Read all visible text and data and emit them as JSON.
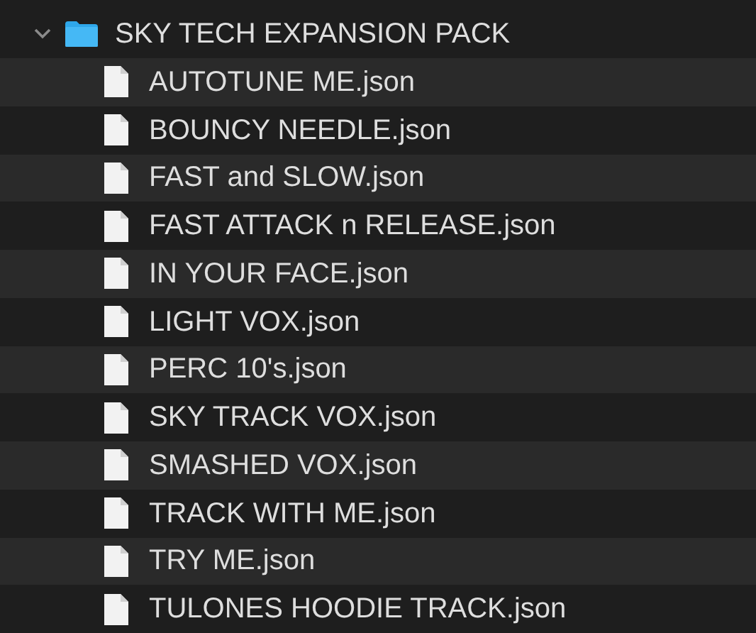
{
  "folder": {
    "name": "SKY TECH EXPANSION PACK",
    "expanded": true,
    "children": [
      {
        "name": "AUTOTUNE ME.json"
      },
      {
        "name": "BOUNCY NEEDLE.json"
      },
      {
        "name": "FAST and SLOW.json"
      },
      {
        "name": "FAST ATTACK n RELEASE.json"
      },
      {
        "name": "IN YOUR FACE.json"
      },
      {
        "name": "LIGHT VOX.json"
      },
      {
        "name": "PERC 10's.json"
      },
      {
        "name": "SKY TRACK VOX.json"
      },
      {
        "name": "SMASHED VOX.json"
      },
      {
        "name": "TRACK WITH ME.json"
      },
      {
        "name": "TRY ME.json"
      },
      {
        "name": "TULONES HOODIE TRACK.json"
      }
    ]
  }
}
